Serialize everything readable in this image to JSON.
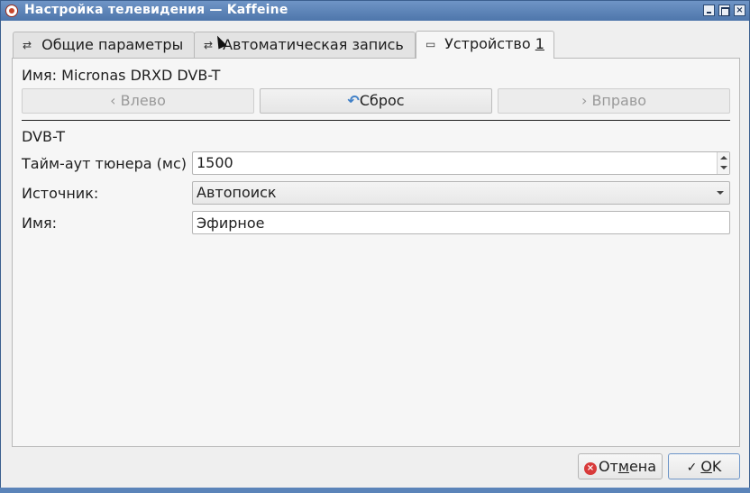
{
  "window": {
    "title": "Настройка телевидения — Kaffeine",
    "controls": {
      "minimize": "minimize",
      "maximize": "maximize",
      "close": "×"
    }
  },
  "tabs": [
    {
      "label": "Общие параметры",
      "icon": "settings-sliders-icon",
      "active": false
    },
    {
      "label": "Автоматическая запись",
      "icon": "settings-sliders-icon",
      "active": false
    },
    {
      "label_prefix": "Устройство ",
      "label_accel": "1",
      "icon": "monitor-icon",
      "active": true
    }
  ],
  "device": {
    "name_label": "Имя: Micronas DRXD DVB-T",
    "nav": {
      "left_label": "Влево",
      "reset_label": "Сброс",
      "right_label": "Вправо"
    },
    "section_label": "DVB-T",
    "fields": {
      "timeout_label": "Тайм-аут тюнера (мс)",
      "timeout_value": "1500",
      "source_label": "Источник:",
      "source_value": "Автопоиск",
      "name_label": "Имя:",
      "name_value": "Эфирное"
    }
  },
  "dialog_buttons": {
    "cancel_prefix": "От",
    "cancel_accel": "м",
    "cancel_suffix": "ена",
    "ok_accel": "O",
    "ok_suffix": "K"
  },
  "colors": {
    "titlebar": "#5a82b6",
    "window_bg": "#efefef",
    "cancel_icon": "#d83a3a",
    "reset_icon": "#3f7fc7"
  }
}
